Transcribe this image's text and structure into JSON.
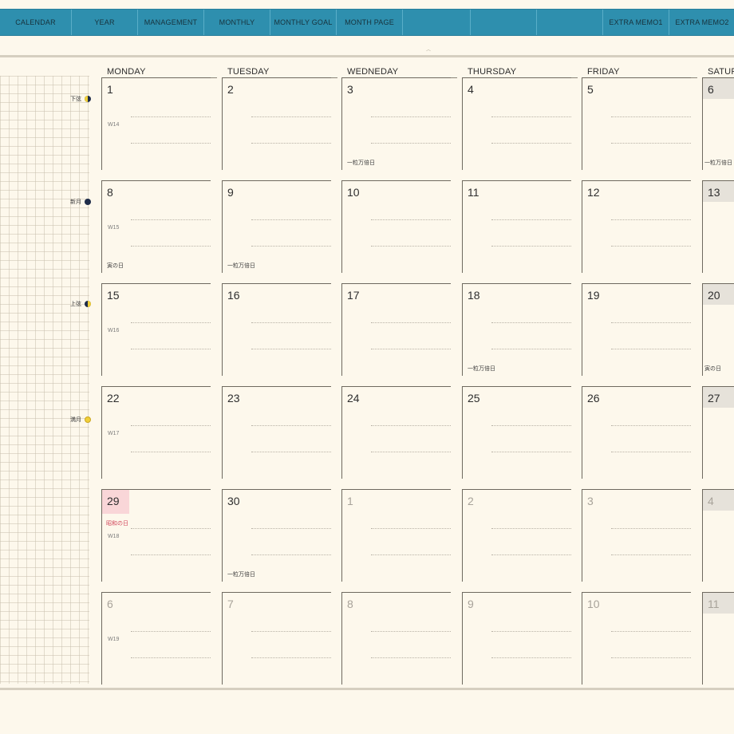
{
  "nav": {
    "tabs": [
      "CALENDAR",
      "YEAR",
      "MANAGEMENT",
      "MONTHLY",
      "MONTHLY GOAL",
      "MONTH PAGE",
      "",
      "",
      "",
      "EXTRA MEMO1",
      "EXTRA MEMO2"
    ]
  },
  "days": [
    "MONDAY",
    "TUESDAY",
    "WEDNEDAY",
    "THURSDAY",
    "FRIDAY",
    "SATURDAY"
  ],
  "moon_phases": [
    {
      "label": "下弦",
      "icon": "last-quarter-moon-icon"
    },
    {
      "label": "新月",
      "icon": "new-moon-icon"
    },
    {
      "label": "上弦",
      "icon": "first-quarter-moon-icon"
    },
    {
      "label": "満月",
      "icon": "full-moon-icon"
    }
  ],
  "weeks": [
    {
      "week": "W14",
      "cells": [
        {
          "day": "1",
          "note": ""
        },
        {
          "day": "2",
          "note": ""
        },
        {
          "day": "3",
          "note": "一粒万倍日"
        },
        {
          "day": "4",
          "note": ""
        },
        {
          "day": "5",
          "note": ""
        },
        {
          "day": "6",
          "note": "一粒万倍日"
        }
      ]
    },
    {
      "week": "W15",
      "cells": [
        {
          "day": "8",
          "note": "寅の日"
        },
        {
          "day": "9",
          "note": "一粒万倍日"
        },
        {
          "day": "10",
          "note": ""
        },
        {
          "day": "11",
          "note": ""
        },
        {
          "day": "12",
          "note": ""
        },
        {
          "day": "13",
          "note": ""
        }
      ]
    },
    {
      "week": "W16",
      "cells": [
        {
          "day": "15",
          "note": ""
        },
        {
          "day": "16",
          "note": ""
        },
        {
          "day": "17",
          "note": ""
        },
        {
          "day": "18",
          "note": "一粒万倍日"
        },
        {
          "day": "19",
          "note": ""
        },
        {
          "day": "20",
          "note": "寅の日"
        }
      ]
    },
    {
      "week": "W17",
      "cells": [
        {
          "day": "22",
          "note": ""
        },
        {
          "day": "23",
          "note": ""
        },
        {
          "day": "24",
          "note": ""
        },
        {
          "day": "25",
          "note": ""
        },
        {
          "day": "26",
          "note": ""
        },
        {
          "day": "27",
          "note": ""
        }
      ]
    },
    {
      "week": "W18",
      "cells": [
        {
          "day": "29",
          "note": "",
          "holiday": "昭和の日"
        },
        {
          "day": "30",
          "note": "一粒万倍日"
        },
        {
          "day": "1",
          "note": "",
          "other": true
        },
        {
          "day": "2",
          "note": "",
          "other": true
        },
        {
          "day": "3",
          "note": "",
          "other": true
        },
        {
          "day": "4",
          "note": "",
          "other": true
        }
      ]
    },
    {
      "week": "W19",
      "cells": [
        {
          "day": "6",
          "note": "",
          "other": true
        },
        {
          "day": "7",
          "note": "",
          "other": true
        },
        {
          "day": "8",
          "note": "",
          "other": true
        },
        {
          "day": "9",
          "note": "",
          "other": true
        },
        {
          "day": "10",
          "note": "",
          "other": true
        },
        {
          "day": "11",
          "note": "",
          "other": true
        }
      ]
    }
  ],
  "colors": {
    "nav": "#2e8fae",
    "holiday": "#f9d6d8",
    "holiday_text": "#d2455a",
    "paper": "#fdf8ec"
  }
}
